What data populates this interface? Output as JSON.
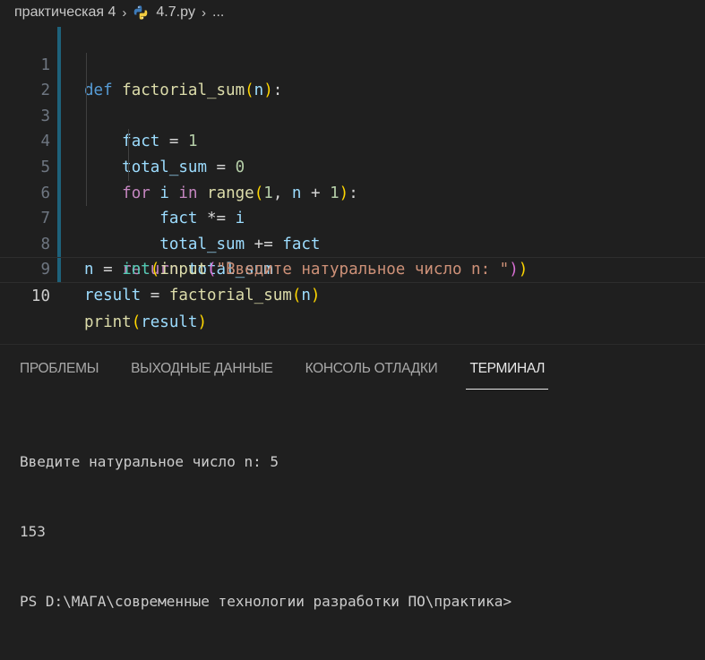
{
  "breadcrumb": {
    "folder": "практическая 4",
    "file": "4.7.py",
    "more": "..."
  },
  "editor": {
    "line_numbers": [
      "1",
      "2",
      "3",
      "4",
      "5",
      "6",
      "7",
      "8",
      "9",
      "10"
    ],
    "current_line": 10,
    "lines": [
      "def factorial_sum(n):",
      "    fact = 1",
      "    total_sum = 0",
      "    for i in range(1, n + 1):",
      "        fact *= i",
      "        total_sum += fact",
      "    return total_sum",
      "n = int(input(\"Введите натуральное число n: \"))",
      "result = factorial_sum(n)",
      "print(result)"
    ],
    "colors": {
      "keyword": "#569cd6",
      "function": "#dcdcaa",
      "variable": "#9cdcfe",
      "number": "#b5cea8",
      "string": "#ce9178"
    }
  },
  "panel": {
    "tabs": [
      {
        "label": "ПРОБЛЕМЫ",
        "active": false
      },
      {
        "label": "ВЫХОДНЫЕ ДАННЫЕ",
        "active": false
      },
      {
        "label": "КОНСОЛЬ ОТЛАДКИ",
        "active": false
      },
      {
        "label": "ТЕРМИНАЛ",
        "active": true
      }
    ],
    "terminal": {
      "prompt_line": "Введите натуральное число n: 5",
      "output_line": "153",
      "ps_line": "PS D:\\МАГА\\современные технологии разработки ПО\\практика>"
    }
  }
}
